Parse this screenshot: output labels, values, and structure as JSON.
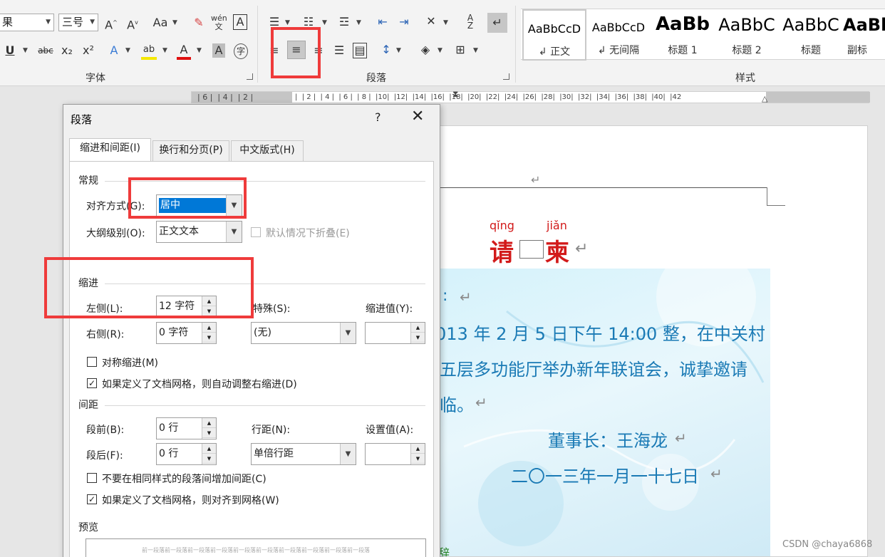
{
  "ribbon": {
    "font_name": "果",
    "font_size": "三号",
    "font_group_label": "字体",
    "paragraph_group_label": "段落",
    "styles_group_label": "样式",
    "styles": [
      {
        "preview": "AaBbCcD",
        "name": "↲ 正文"
      },
      {
        "preview": "AaBbCcD",
        "name": "↲ 无间隔"
      },
      {
        "preview": "AaBb",
        "name": "标题 1"
      },
      {
        "preview": "AaBbC",
        "name": "标题 2"
      },
      {
        "preview": "AaBbC",
        "name": "标题"
      },
      {
        "preview": "AaBl",
        "name": "副标"
      }
    ]
  },
  "ruler": {
    "left_ticks": "| 6 |  | 4 |  | 2 |",
    "right_ticks": "|  | 2 |  | 4 |  | 6 |  | 8 |  |10|  |12|  |14|  |16|  |18|  |20|  |22|  |24|  |26|  |28|  |30|  |32|  |34|  |36|  |38|  |40|  |42"
  },
  "dialog": {
    "title": "段落",
    "help": "?",
    "tabs": [
      "缩进和间距(I)",
      "换行和分页(P)",
      "中文版式(H)"
    ],
    "general_section": "常规",
    "alignment_label": "对齐方式(G):",
    "alignment_value": "居中",
    "outline_label": "大纲级别(O):",
    "outline_value": "正文文本",
    "collapse_label": "默认情况下折叠(E)",
    "indent_section": "缩进",
    "left_label": "左侧(L):",
    "left_value": "12 字符",
    "right_label": "右侧(R):",
    "right_value": "0 字符",
    "special_label": "特殊(S):",
    "special_value": "(无)",
    "indent_by_label": "缩进值(Y):",
    "mirror_label": "对称缩进(M)",
    "auto_right_label": "如果定义了文档网格，则自动调整右缩进(D)",
    "spacing_section": "间距",
    "before_label": "段前(B):",
    "before_value": "0 行",
    "after_label": "段后(F):",
    "after_value": "0 行",
    "line_spacing_label": "行距(N):",
    "line_spacing_value": "单倍行距",
    "at_label": "设置值(A):",
    "no_space_label": "不要在相同样式的段落间增加间距(C)",
    "snap_grid_label": "如果定义了文档网格，则对齐到网格(W)",
    "preview_section": "预览",
    "preview_text": "前一段落前一段落前一段落前一段落前一段落前一段落前一段落前一段落前一段落前一段落"
  },
  "document": {
    "ruby1": "qǐng",
    "ruby2": "jiǎn",
    "title_char1": "请",
    "title_char2": "柬",
    "line_colon": ":",
    "line1": "013 年 2 月 5 日下午 14:00 整，在中关村",
    "line2": "五层多功能厅举办新年联谊会，诚挚邀请",
    "line3": "临。",
    "signer": "董事长：王海龙",
    "date": "二〇一三年一月一十七日",
    "para_mark": "↵",
    "bottom_partial": "辞"
  },
  "watermark": "CSDN @chaya6868",
  "colors": {
    "highlight": "#ef3b3b",
    "doc_blue": "#1a7ab5",
    "title_red": "#d21a1a"
  }
}
